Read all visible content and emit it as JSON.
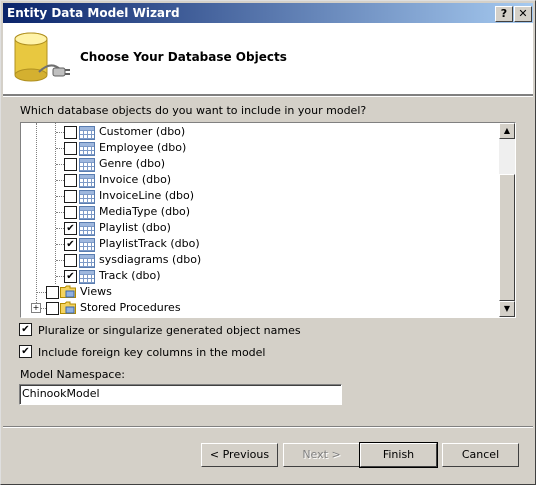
{
  "window": {
    "title": "Entity Data Model Wizard",
    "help_label": "?",
    "close_label": "✕"
  },
  "header": {
    "title": "Choose Your Database Objects",
    "icon": "database-connect-icon"
  },
  "prompt": "Which database objects do you want to include in your model?",
  "tree": {
    "tables": [
      {
        "label": "Customer (dbo)",
        "checked": false,
        "check": ""
      },
      {
        "label": "Employee (dbo)",
        "checked": false,
        "check": ""
      },
      {
        "label": "Genre (dbo)",
        "checked": false,
        "check": ""
      },
      {
        "label": "Invoice (dbo)",
        "checked": false,
        "check": ""
      },
      {
        "label": "InvoiceLine (dbo)",
        "checked": false,
        "check": ""
      },
      {
        "label": "MediaType (dbo)",
        "checked": false,
        "check": ""
      },
      {
        "label": "Playlist (dbo)",
        "checked": true,
        "check": "✔"
      },
      {
        "label": "PlaylistTrack (dbo)",
        "checked": true,
        "check": "✔"
      },
      {
        "label": "sysdiagrams (dbo)",
        "checked": false,
        "check": ""
      },
      {
        "label": "Track (dbo)",
        "checked": true,
        "check": "✔"
      }
    ],
    "views_label": "Views",
    "stored_procedures_label": "Stored Procedures",
    "stored_procedures_expander": "+"
  },
  "options": {
    "pluralize": {
      "label": "Pluralize or singularize generated object names",
      "checked": true,
      "check": "✔"
    },
    "foreign_keys": {
      "label": "Include foreign key columns in the model",
      "checked": true,
      "check": "✔"
    }
  },
  "namespace": {
    "label": "Model Namespace:",
    "value": "ChinookModel"
  },
  "buttons": {
    "previous": "< Previous",
    "next": "Next >",
    "finish": "Finish",
    "cancel": "Cancel"
  },
  "scrollbar": {
    "up": "▲",
    "down": "▼"
  }
}
